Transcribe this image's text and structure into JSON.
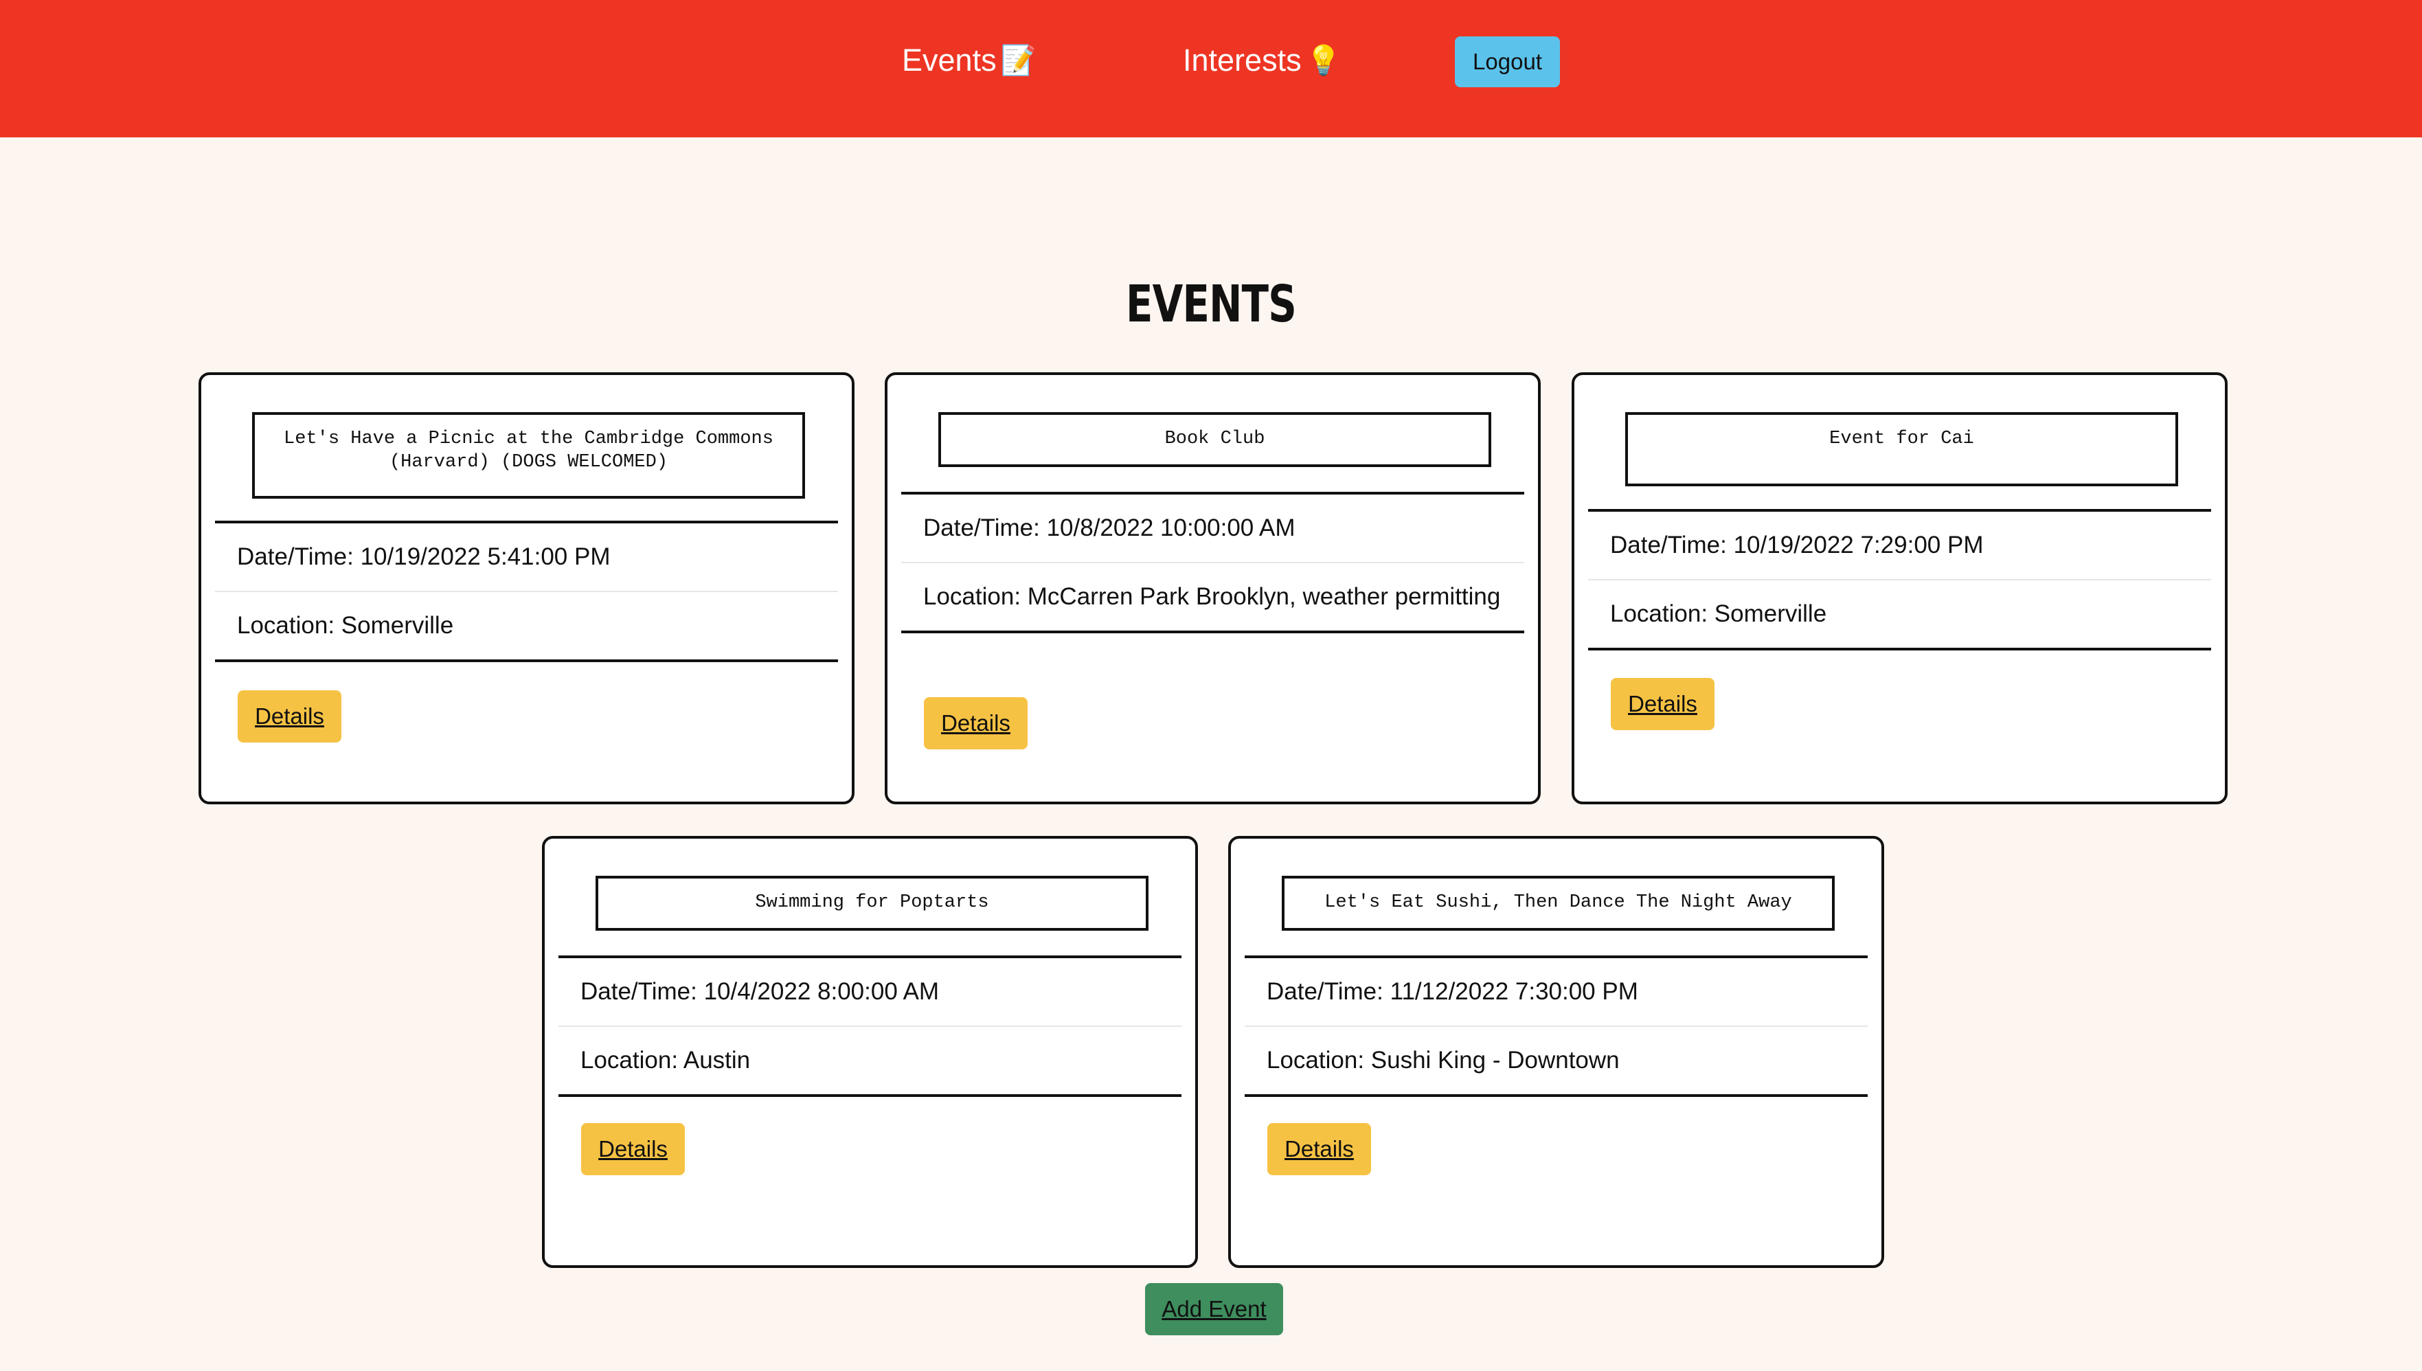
{
  "nav": {
    "events_label": "Events",
    "events_icon": "📝",
    "interests_label": "Interests",
    "interests_icon": "💡",
    "logout_label": "Logout"
  },
  "page": {
    "title": "EVENTS"
  },
  "events": [
    {
      "title": "Let's Have a Picnic at the Cambridge Commons (Harvard) (DOGS WELCOMED)",
      "datetime": "Date/Time: 10/19/2022 5:41:00 PM",
      "location": "Location: Somerville",
      "details_label": "Details"
    },
    {
      "title": "Book Club",
      "datetime": "Date/Time: 10/8/2022 10:00:00 AM",
      "location": "Location: McCarren Park Brooklyn, weather permitting",
      "details_label": "Details"
    },
    {
      "title": "Event for Cai",
      "datetime": "Date/Time: 10/19/2022 7:29:00 PM",
      "location": "Location: Somerville",
      "details_label": "Details"
    },
    {
      "title": "Swimming for Poptarts",
      "datetime": "Date/Time: 10/4/2022 8:00:00 AM",
      "location": "Location: Austin",
      "details_label": "Details"
    },
    {
      "title": "Let's Eat Sushi, Then Dance The Night Away",
      "datetime": "Date/Time: 11/12/2022 7:30:00 PM",
      "location": "Location: Sushi King - Downtown",
      "details_label": "Details"
    }
  ],
  "footer": {
    "add_event_label": "Add Event"
  },
  "colors": {
    "navbar": "#ee3524",
    "background": "#fdf5f0",
    "logout_button": "#5bc3eb",
    "details_button": "#f6c244",
    "add_event_button": "#3e8e5e"
  }
}
